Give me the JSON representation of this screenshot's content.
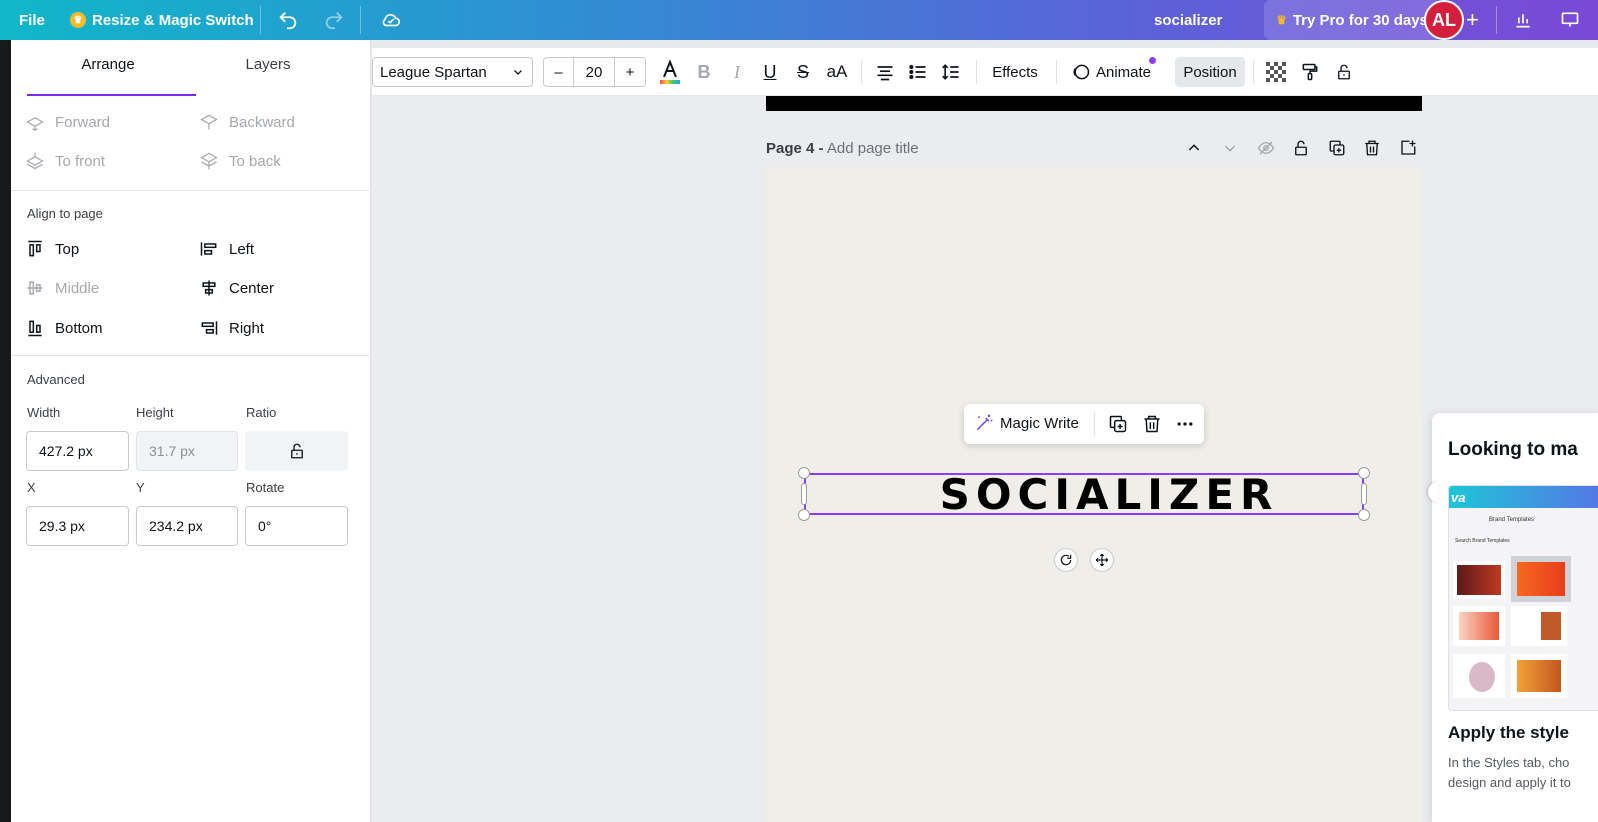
{
  "topbar": {
    "file": "File",
    "resize": "Resize & Magic Switch",
    "doc_title": "socializer",
    "try_pro": "Try Pro for 30 days",
    "avatar_initials": "AL"
  },
  "sidepanel": {
    "tabs": [
      "Arrange",
      "Layers"
    ],
    "order": {
      "forward": "Forward",
      "backward": "Backward",
      "to_front": "To front",
      "to_back": "To back"
    },
    "align_title": "Align to page",
    "align": {
      "top": "Top",
      "left": "Left",
      "middle": "Middle",
      "center": "Center",
      "bottom": "Bottom",
      "right": "Right"
    },
    "advanced_title": "Advanced",
    "labels": {
      "width": "Width",
      "height": "Height",
      "ratio": "Ratio",
      "x": "X",
      "y": "Y",
      "rotate": "Rotate"
    },
    "values": {
      "width": "427.2 px",
      "height": "31.7 px",
      "x": "29.3 px",
      "y": "234.2 px",
      "rotate": "0°"
    }
  },
  "toolbar": {
    "font": "League Spartan",
    "minus": "–",
    "size": "20",
    "plus": "+",
    "case": "aA",
    "effects": "Effects",
    "animate": "Animate",
    "position": "Position"
  },
  "canvas": {
    "page_label": "Page 4 -",
    "page_title_placeholder": "Add page title",
    "headline": "SOCIALIZER",
    "magic_write": "Magic Write"
  },
  "help": {
    "title": "Looking to ma",
    "subtitle": "Apply the style",
    "text_line1": "In the Styles tab, cho",
    "text_line2": "design and apply it to",
    "thumb_logo": "va",
    "thumb_header": "Brand Templates",
    "thumb_search": "Search Brand Templates"
  },
  "colors": {
    "accent": "#8b3dff",
    "avatar": "#d41e3c",
    "page_bg": "#f0eee9"
  }
}
